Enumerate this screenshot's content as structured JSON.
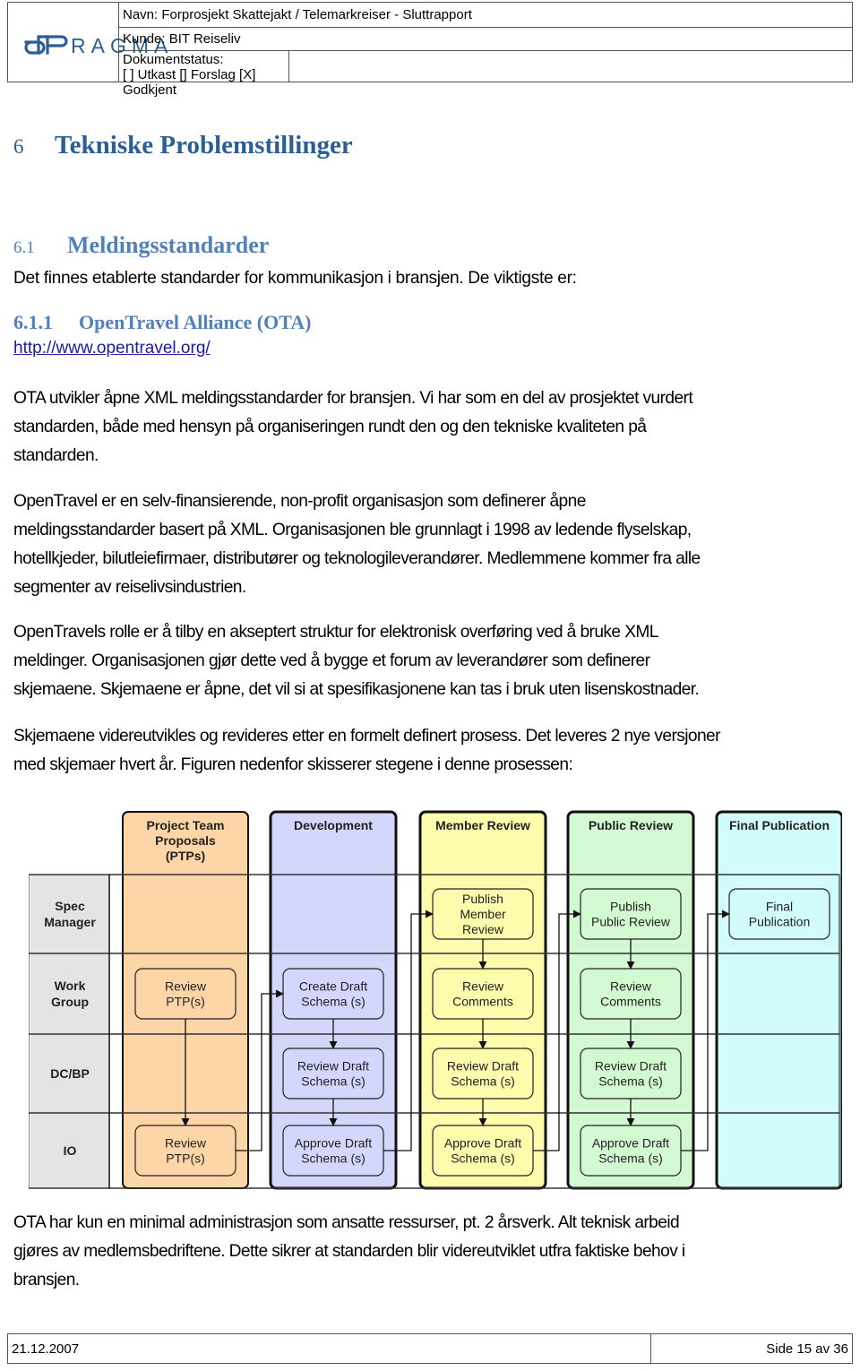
{
  "header": {
    "logo_text": "PRAGMA",
    "name_line": "Navn: Forprosjekt Skattejakt / Telemarkreiser - Sluttrapport",
    "customer_line": "Kunde: BIT Reiseliv",
    "status_label": "Dokumentstatus:",
    "status_options": "[ ] Utkast [] Forslag [X] Godkjent"
  },
  "section": {
    "number": "6",
    "title": "Tekniske Problemstillinger"
  },
  "subsection": {
    "number": "6.1",
    "title": "Meldingsstandarder",
    "intro": "Det finnes etablerte standarder for kommunikasjon i bransjen.  De viktigste er:"
  },
  "subsubsection": {
    "number": "6.1.1",
    "title": "OpenTravel Alliance (OTA)",
    "link": "http://www.opentravel.org/"
  },
  "paragraphs": [
    [
      "OTA utvikler åpne XML meldingsstandarder for bransjen.  Vi har som en del av prosjektet vurdert",
      "standarden, både med hensyn på organiseringen rundt den og den tekniske kvaliteten på",
      "standarden."
    ],
    [
      "OpenTravel er en selv-finansierende, non-profit organisasjon som definerer åpne",
      "meldingsstandarder basert på XML.  Organisasjonen ble grunnlagt i 1998 av ledende flyselskap,",
      "hotellkjeder, bilutleiefirmaer, distributører og teknologileverandører.  Medlemmene kommer fra alle",
      "segmenter av reiselivsindustrien."
    ],
    [
      "OpenTravels rolle er å tilby en akseptert struktur for elektronisk overføring ved å bruke XML",
      "meldinger.  Organisasjonen gjør dette ved å bygge et forum av leverandører som definerer",
      "skjemaene.  Skjemaene er åpne, det vil si at spesifikasjonene kan tas i bruk uten lisenskostnader."
    ],
    [
      "Skjemaene videreutvikles og revideres etter en formelt definert prosess.  Det leveres 2 nye versjoner",
      "med skjemaer hvert år.  Figuren nedenfor skisserer stegene i denne prosessen:"
    ],
    [
      "OTA har kun en minimal administrasjon som ansatte ressurser, pt. 2 årsverk.  Alt teknisk arbeid",
      "gjøres av medlemsbedriftene.  Dette sikrer at standarden blir videreutviklet utfra faktiske behov i",
      "bransjen."
    ]
  ],
  "diagram": {
    "phases": [
      {
        "title": [
          "Project Team",
          "Proposals",
          "(PTPs)"
        ],
        "color": "#fdd5a6"
      },
      {
        "title": [
          "Development"
        ],
        "color": "#d4d6fc"
      },
      {
        "title": [
          "Member Review"
        ],
        "color": "#fdfbac"
      },
      {
        "title": [
          "Public Review"
        ],
        "color": "#d2f9d2"
      },
      {
        "title": [
          "Final  Publication"
        ],
        "color": "#d2fcfc"
      }
    ],
    "roles": [
      [
        "Spec",
        "Manager"
      ],
      [
        "Work",
        "Group"
      ],
      [
        "DC/BP"
      ],
      [
        "IO"
      ]
    ],
    "role_color": "#e4e4e4",
    "steps": [
      {
        "phase": 0,
        "role": 1,
        "label": [
          "Review",
          "PTP(s)"
        ]
      },
      {
        "phase": 0,
        "role": 3,
        "label": [
          "Review",
          "PTP(s)"
        ]
      },
      {
        "phase": 1,
        "role": 1,
        "label": [
          "Create Draft",
          "Schema (s)"
        ]
      },
      {
        "phase": 1,
        "role": 2,
        "label": [
          "Review Draft",
          "Schema (s)"
        ]
      },
      {
        "phase": 1,
        "role": 3,
        "label": [
          "Approve Draft",
          "Schema (s)"
        ]
      },
      {
        "phase": 2,
        "role": 0,
        "label": [
          "Publish",
          "Member",
          "Review"
        ]
      },
      {
        "phase": 2,
        "role": 1,
        "label": [
          "Review",
          "Comments"
        ]
      },
      {
        "phase": 2,
        "role": 2,
        "label": [
          "Review Draft",
          "Schema (s)"
        ]
      },
      {
        "phase": 2,
        "role": 3,
        "label": [
          "Approve Draft",
          "Schema (s)"
        ]
      },
      {
        "phase": 3,
        "role": 0,
        "label": [
          "Publish",
          "Public Review"
        ]
      },
      {
        "phase": 3,
        "role": 1,
        "label": [
          "Review",
          "Comments"
        ]
      },
      {
        "phase": 3,
        "role": 2,
        "label": [
          "Review Draft",
          "Schema (s)"
        ]
      },
      {
        "phase": 3,
        "role": 3,
        "label": [
          "Approve Draft",
          "Schema (s)"
        ]
      },
      {
        "phase": 4,
        "role": 0,
        "label": [
          "Final",
          "Publication"
        ]
      }
    ]
  },
  "footer": {
    "date": "21.12.2007",
    "page": "Side 15 av 36"
  }
}
